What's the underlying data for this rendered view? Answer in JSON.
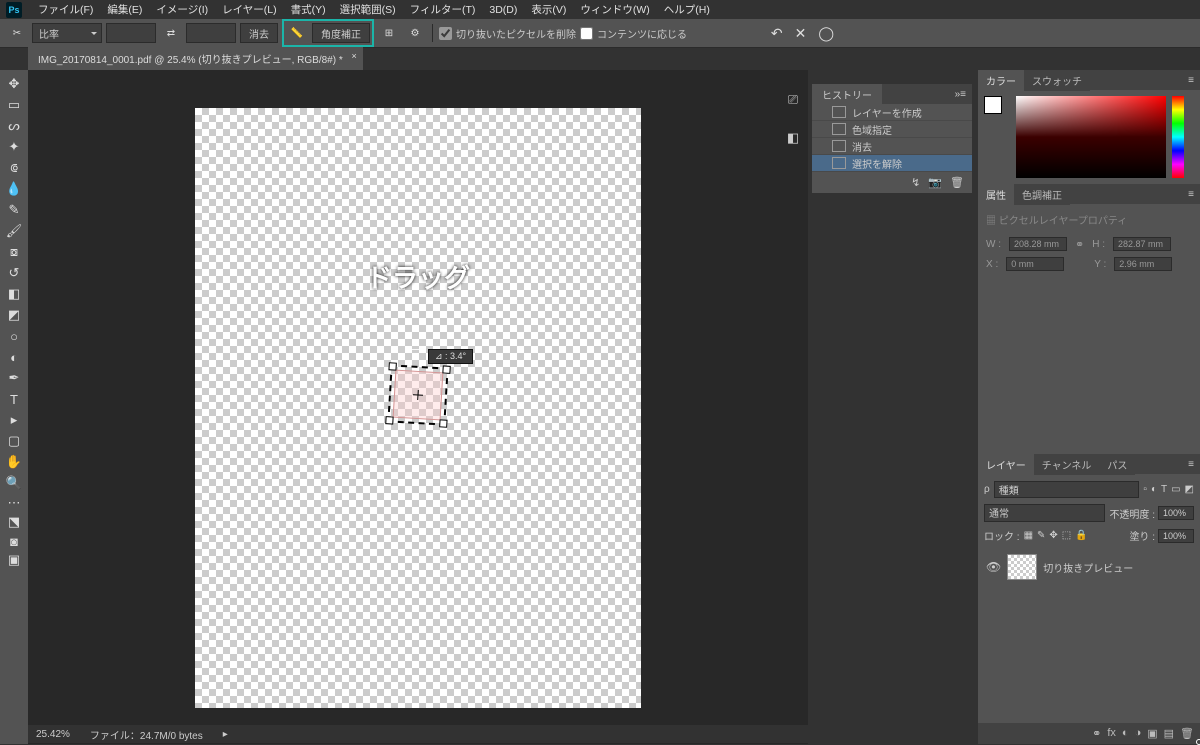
{
  "app": {
    "logo": "Ps"
  },
  "menu": [
    "ファイル(F)",
    "編集(E)",
    "イメージ(I)",
    "レイヤー(L)",
    "書式(Y)",
    "選択範囲(S)",
    "フィルター(T)",
    "3D(D)",
    "表示(V)",
    "ウィンドウ(W)",
    "ヘルプ(H)"
  ],
  "options": {
    "ratio_label": "比率",
    "clear": "消去",
    "straighten": "角度補正",
    "delete_crop_px": "切り抜いたピクセルを削除",
    "content_aware": "コンテンツに応じる"
  },
  "undo_icons": [
    "↶",
    "✕",
    "◯"
  ],
  "doc_tab": "IMG_20170814_0001.pdf @ 25.4% (切り抜きプレビュー, RGB/8#) *",
  "overlay": {
    "drag": "ドラッグ",
    "arrow": "→",
    "angle": "⊿ : 3.4°"
  },
  "history": {
    "title": "ヒストリー",
    "items": [
      "レイヤーを作成",
      "色域指定",
      "消去",
      "選択を解除"
    ]
  },
  "right": {
    "color_tab": "カラー",
    "swatch_tab": "スウォッチ",
    "attr_tab": "属性",
    "adjust_tab": "色調補正",
    "pixel_layer_props": "ピクセルレイヤープロパティ",
    "W_label": "W :",
    "W_val": "208.28 mm",
    "H_label": "H :",
    "H_val": "282.87 mm",
    "X_label": "X :",
    "X_val": "0 mm",
    "Y_label": "Y :",
    "Y_val": "2.96 mm",
    "layers_tab": "レイヤー",
    "channels_tab": "チャンネル",
    "paths_tab": "パス",
    "search_ph": "種類",
    "blend": "通常",
    "opacity_label": "不透明度 :",
    "opacity_val": "100%",
    "lock_label": "ロック :",
    "fill_label": "塗り :",
    "fill_val": "100%",
    "layer_name": "切り抜きプレビュー"
  },
  "status": {
    "zoom": "25.42%",
    "filesize": "ファイル：24.7M/0 bytes"
  }
}
